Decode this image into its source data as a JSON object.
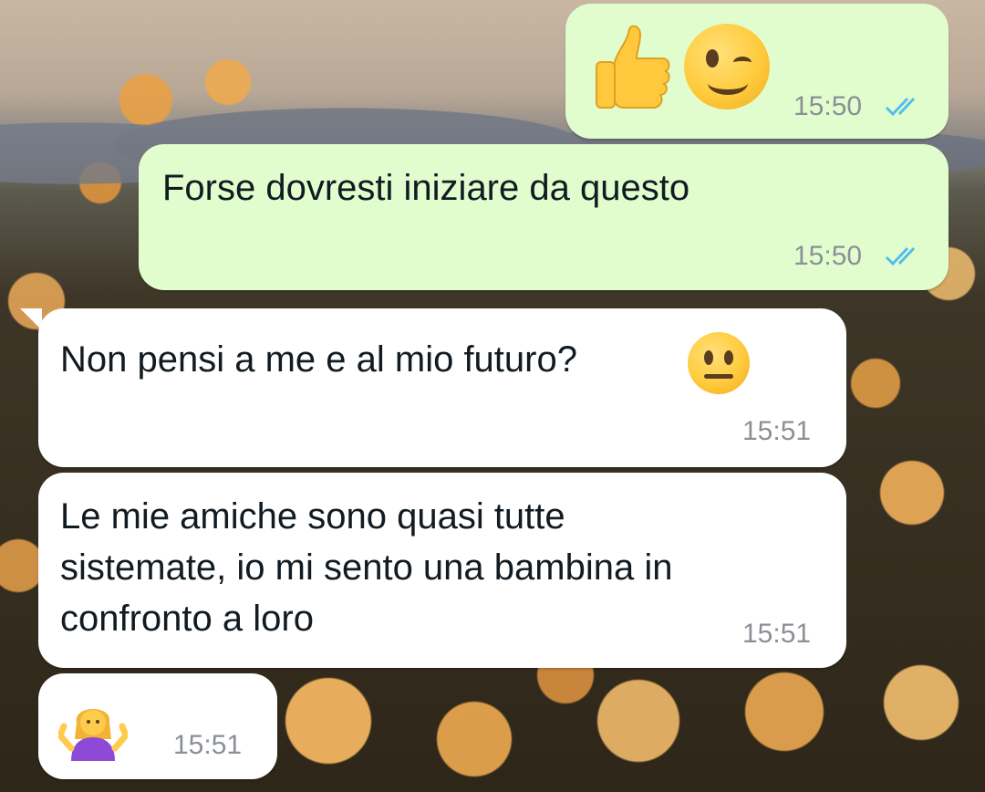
{
  "messages": [
    {
      "direction": "outgoing",
      "text": "",
      "emoji": [
        "thumbs-up-emoji",
        "winking-face-emoji"
      ],
      "time": "15:50",
      "status": "read"
    },
    {
      "direction": "outgoing",
      "text": "Forse dovresti iniziare da questo",
      "time": "15:50",
      "status": "read"
    },
    {
      "direction": "incoming",
      "text": "Non pensi a me e al mio futuro?",
      "emoji": [
        "neutral-face-emoji"
      ],
      "time": "15:51"
    },
    {
      "direction": "incoming",
      "lines": [
        "Le mie amiche sono quasi tutte",
        "sistemate, io mi sento una bambina in",
        "confronto a loro"
      ],
      "time": "15:51"
    },
    {
      "direction": "incoming",
      "text": "",
      "emoji": [
        "person-shrugging-emoji"
      ],
      "time": "15:51"
    }
  ],
  "colors": {
    "outgoing_bubble": "#e2fdcd",
    "incoming_bubble": "#ffffff",
    "read_ticks": "#53bdeb",
    "timestamp": "#8a9096"
  }
}
